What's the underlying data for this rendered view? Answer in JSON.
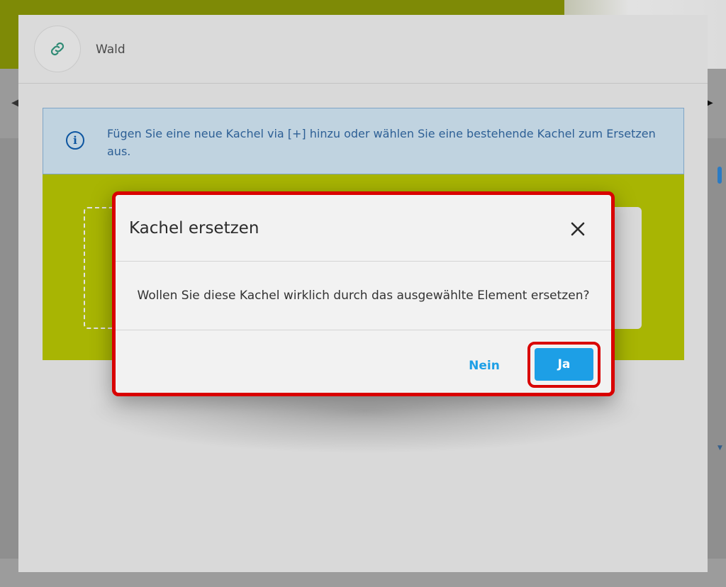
{
  "panel": {
    "title": "Wald",
    "info_text": "Fügen Sie eine neue Kachel via [+] hinzu oder wählen Sie eine bestehende Kachel zum Ersetzen aus."
  },
  "dialog": {
    "title": "Kachel ersetzen",
    "message": "Wollen Sie diese Kachel wirklich durch das ausgewählte Element ersetzen?",
    "no_label": "Nein",
    "yes_label": "Ja"
  },
  "colors": {
    "accent": "#1d9fe6",
    "highlight": "#d90000",
    "tile_green": "#a8b503"
  },
  "icons": [
    "link-icon",
    "info-icon",
    "close-icon"
  ]
}
